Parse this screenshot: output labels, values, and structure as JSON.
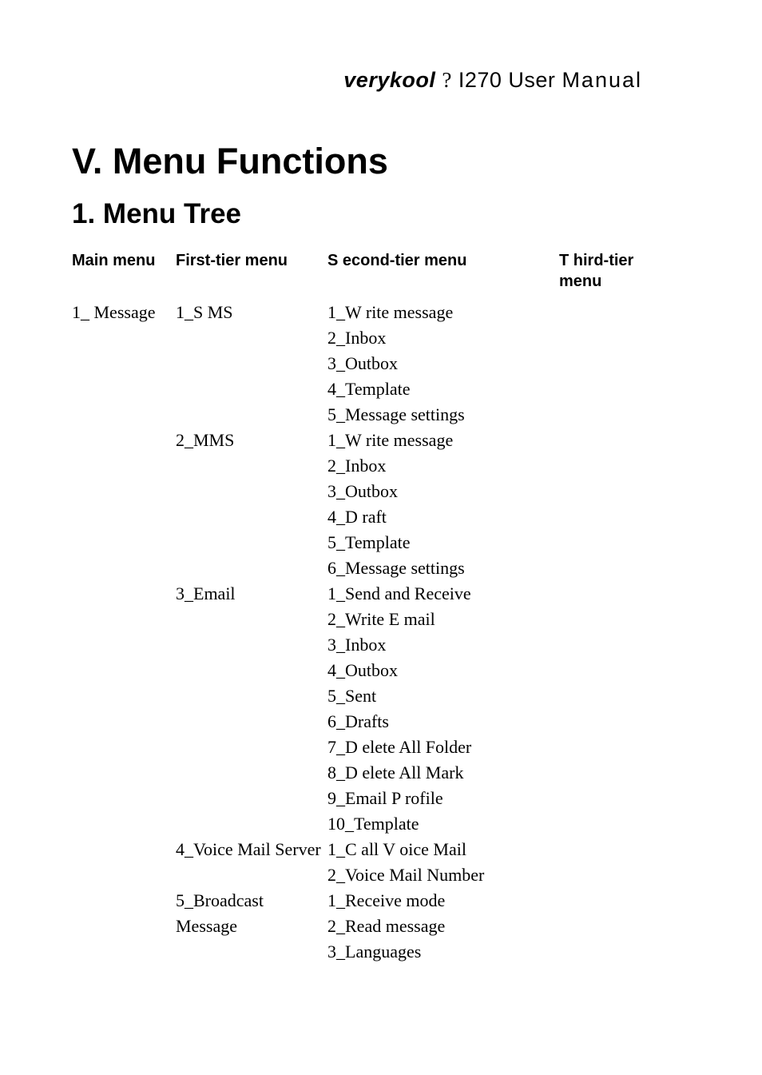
{
  "header": {
    "brand": "verykool",
    "q": "?",
    "model": "I270 User",
    "manual": "Manual"
  },
  "h1": "V. Menu Functions",
  "h2": "1. Menu Tree",
  "heads": {
    "main": "Main menu",
    "first": "First-tier menu",
    "second": "S econd-tier menu",
    "third": "T hird-tier menu"
  },
  "col_main": [
    "1_ Message"
  ],
  "col_first": {
    "sms": "1_S MS",
    "mms": "2_MMS",
    "email": "3_Email",
    "voice": "4_Voice Mail Server",
    "broadcast": "5_Broadcast Message"
  },
  "col_second": [
    "1_W rite message",
    "2_Inbox",
    "3_Outbox",
    "4_Template",
    "5_Message settings",
    "1_W rite message",
    "2_Inbox",
    "3_Outbox",
    "4_D raft",
    "5_Template",
    "6_Message settings",
    "1_Send  and Receive",
    "2_Write E mail",
    "3_Inbox",
    "4_Outbox",
    "5_Sent",
    "6_Drafts",
    "7_D elete All Folder",
    "8_D elete All Mark",
    "9_Email P rofile",
    "10_Template",
    "1_C all V oice Mail",
    "2_Voice Mail Number",
    "1_Receive mode",
    "2_Read message",
    "3_Languages"
  ]
}
